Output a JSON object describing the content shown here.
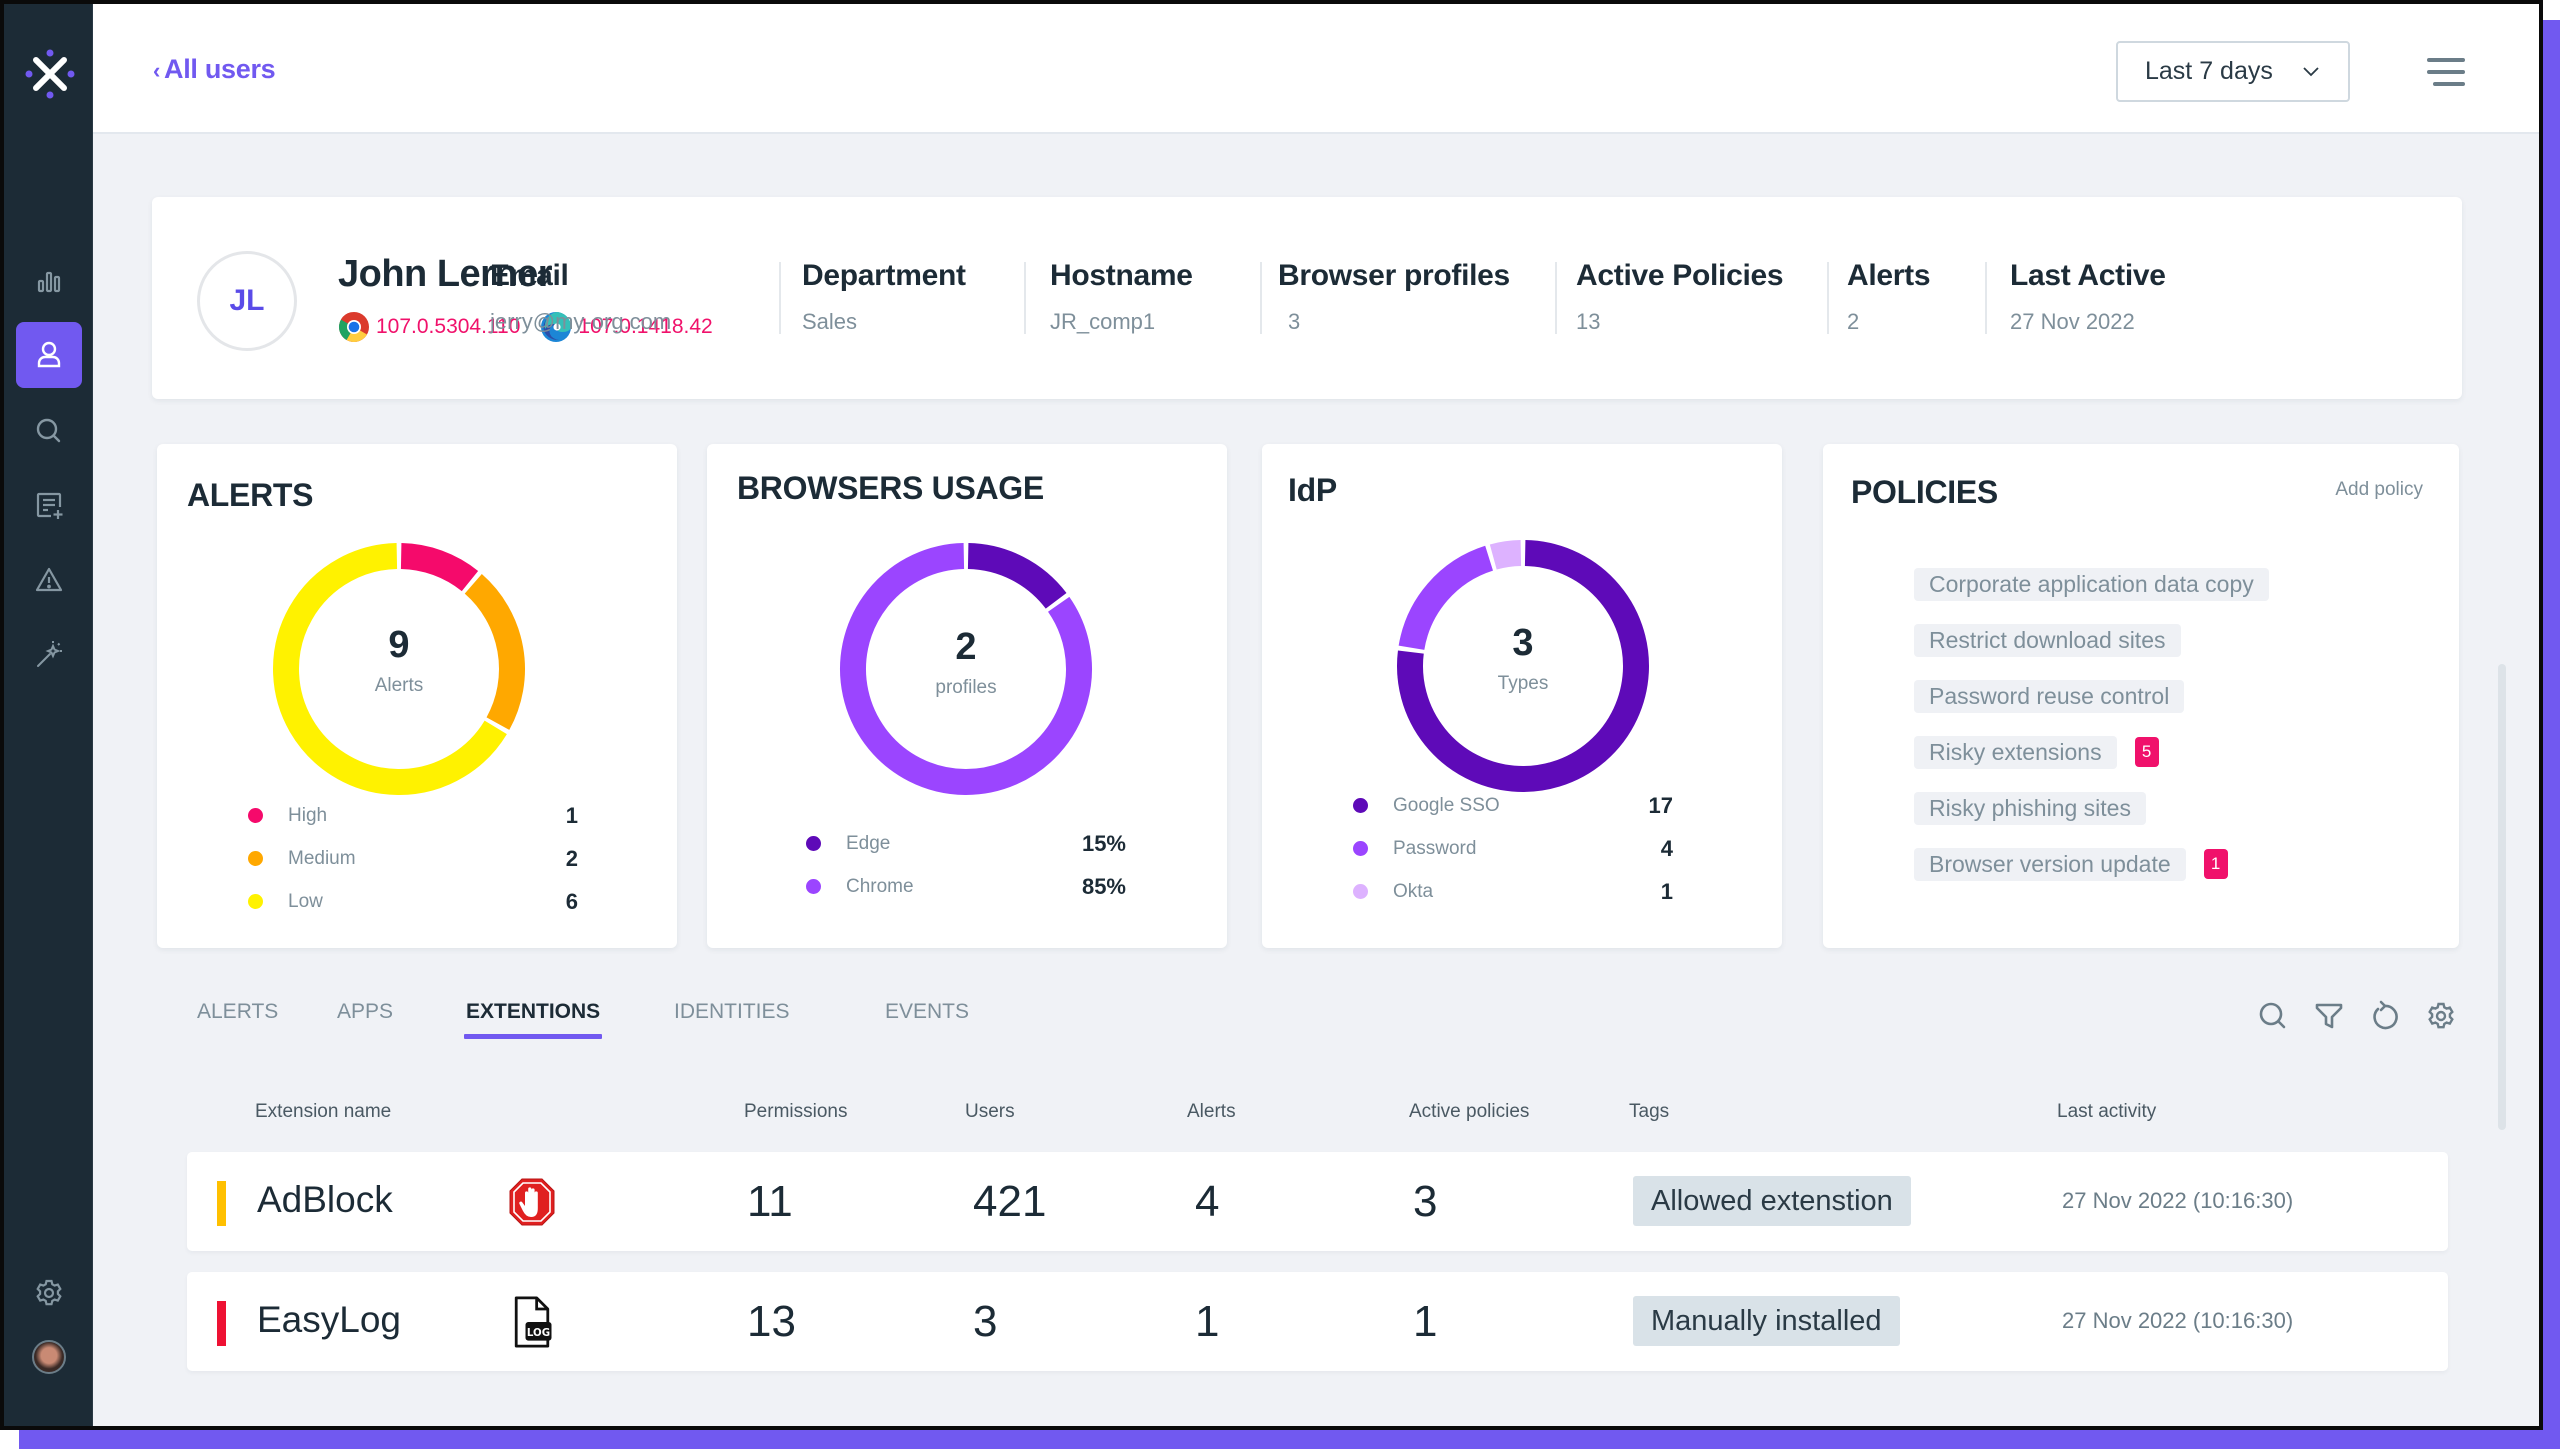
{
  "app": {
    "logo_icon": "x-logo-icon",
    "accent_color": "#7159f0",
    "sidebar_bg": "#1c2b36"
  },
  "sidebar": {
    "items": [
      {
        "name": "analytics",
        "icon": "bar-chart-icon",
        "active": false
      },
      {
        "name": "users",
        "icon": "user-icon",
        "active": true
      },
      {
        "name": "search",
        "icon": "search-icon",
        "active": false
      },
      {
        "name": "policies",
        "icon": "list-add-icon",
        "active": false
      },
      {
        "name": "alerts",
        "icon": "warning-icon",
        "active": false
      },
      {
        "name": "magic",
        "icon": "magic-wand-icon",
        "active": false
      }
    ],
    "bottom": [
      {
        "name": "settings",
        "icon": "gear-icon"
      },
      {
        "name": "profile",
        "icon": "user-avatar-photo"
      }
    ]
  },
  "topbar": {
    "back_chevron": "‹",
    "back_label": "All users",
    "range_select": {
      "value": "Last 7 days"
    },
    "menu_icon": "hamburger-icon"
  },
  "user": {
    "initials": "JL",
    "name": "John Lerner",
    "browsers": [
      {
        "browser": "Chrome",
        "icon": "chrome-icon",
        "version": "107.0.5304.110"
      },
      {
        "browser": "Edge",
        "icon": "edge-icon",
        "version": "107.0.1418.42"
      }
    ],
    "fields": [
      {
        "label": "Email",
        "value": "jerry@my-org.com"
      },
      {
        "label": "Department",
        "value": "Sales"
      },
      {
        "label": "Hostname",
        "value": "JR_comp1"
      },
      {
        "label": "Browser profiles",
        "value": "3"
      },
      {
        "label": "Active Policies",
        "value": "13"
      },
      {
        "label": "Alerts",
        "value": "2"
      },
      {
        "label": "Last Active",
        "value": "27 Nov 2022"
      }
    ]
  },
  "cards": {
    "alerts": {
      "title": "ALERTS",
      "total": "9",
      "total_label": "Alerts",
      "legend": [
        {
          "label": "High",
          "value": "1",
          "color": "#f50a6b"
        },
        {
          "label": "Medium",
          "value": "2",
          "color": "#ffa800"
        },
        {
          "label": "Low",
          "value": "6",
          "color": "#fff200"
        }
      ]
    },
    "browsers": {
      "title": "BROWSERS USAGE",
      "total": "2",
      "total_label": "profiles",
      "legend": [
        {
          "label": "Edge",
          "value": "15%",
          "color": "#5e0ab8"
        },
        {
          "label": "Chrome",
          "value": "85%",
          "color": "#9b45ff"
        }
      ]
    },
    "idp": {
      "title": "IdP",
      "total": "3",
      "total_label": "Types",
      "legend": [
        {
          "label": "Google SSO",
          "value": "17",
          "color": "#5e0ab8"
        },
        {
          "label": "Password",
          "value": "4",
          "color": "#9b45ff"
        },
        {
          "label": "Okta",
          "value": "1",
          "color": "#ddb2ff"
        }
      ]
    },
    "policies": {
      "title": "POLICIES",
      "add_label": "Add policy",
      "items": [
        {
          "label": "Corporate application data copy",
          "badge": null
        },
        {
          "label": "Restrict download sites",
          "badge": null
        },
        {
          "label": "Password reuse control",
          "badge": null
        },
        {
          "label": "Risky extensions",
          "badge": "5"
        },
        {
          "label": "Risky phishing sites",
          "badge": null
        },
        {
          "label": "Browser version update",
          "badge": "1"
        }
      ]
    }
  },
  "chart_data": [
    {
      "type": "pie",
      "title": "ALERTS",
      "center_value": 9,
      "center_label": "Alerts",
      "categories": [
        "High",
        "Medium",
        "Low"
      ],
      "values": [
        1,
        2,
        6
      ],
      "colors": [
        "#f50a6b",
        "#ffa800",
        "#fff200"
      ]
    },
    {
      "type": "pie",
      "title": "BROWSERS USAGE",
      "center_value": 2,
      "center_label": "profiles",
      "categories": [
        "Edge",
        "Chrome"
      ],
      "values": [
        15,
        85
      ],
      "colors": [
        "#5e0ab8",
        "#9b45ff"
      ]
    },
    {
      "type": "pie",
      "title": "IdP",
      "center_value": 3,
      "center_label": "Types",
      "categories": [
        "Google SSO",
        "Password",
        "Okta"
      ],
      "values": [
        17,
        4,
        1
      ],
      "colors": [
        "#5e0ab8",
        "#9b45ff",
        "#ddb2ff"
      ]
    }
  ],
  "tabs": {
    "items": [
      "ALERTS",
      "APPS",
      "EXTENTIONS",
      "IDENTITIES",
      "EVENTS"
    ],
    "active": "EXTENTIONS",
    "tools": [
      "search-icon",
      "filter-icon",
      "refresh-icon",
      "gear-icon"
    ]
  },
  "table": {
    "columns": [
      "Extension name",
      "Permissions",
      "Users",
      "Alerts",
      "Active policies",
      "Tags",
      "Last activity"
    ],
    "rows": [
      {
        "name": "AdBlock",
        "icon": "adblock-hand-icon",
        "severity_color": "#ffc000",
        "permissions": "11",
        "users": "421",
        "alerts": "4",
        "active_policies": "3",
        "tag": "Allowed extenstion",
        "last_activity": "27 Nov 2022 (10:16:30)"
      },
      {
        "name": "EasyLog",
        "icon": "log-file-icon",
        "severity_color": "#ee1133",
        "permissions": "13",
        "users": "3",
        "alerts": "1",
        "active_policies": "1",
        "tag": "Manually installed",
        "last_activity": "27 Nov 2022  (10:16:30)"
      }
    ]
  }
}
